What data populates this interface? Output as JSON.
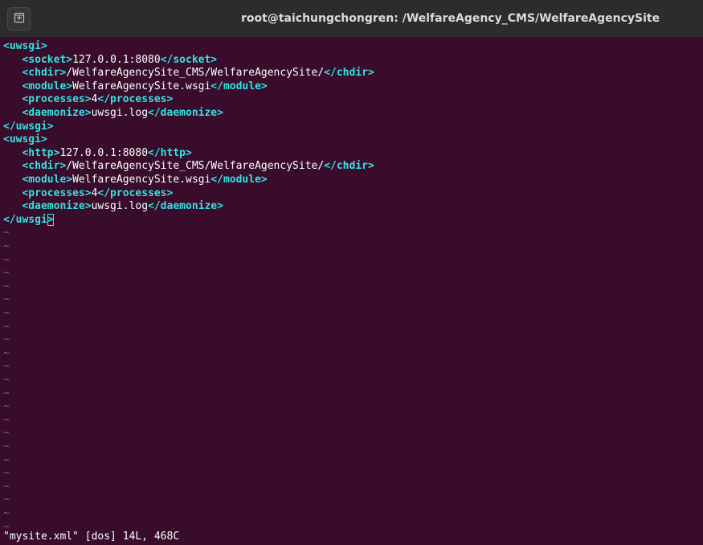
{
  "window": {
    "title": "root@taichungchongren: /WelfareAgency_CMS/WelfareAgencySite",
    "new_tab_icon": "new-tab-icon"
  },
  "lines": [
    [
      {
        "t": "<uwsgi>",
        "c": "tag"
      }
    ],
    [
      {
        "t": "   "
      },
      {
        "t": "<socket>",
        "c": "tag"
      },
      {
        "t": "127.0.0.1:8080"
      },
      {
        "t": "</socket>",
        "c": "tag"
      }
    ],
    [
      {
        "t": "   "
      },
      {
        "t": "<chdir>",
        "c": "tag"
      },
      {
        "t": "/WelfareAgencySite_CMS/WelfareAgencySite/"
      },
      {
        "t": "</chdir>",
        "c": "tag"
      }
    ],
    [
      {
        "t": "   "
      },
      {
        "t": "<module>",
        "c": "tag"
      },
      {
        "t": "WelfareAgencySite.wsgi"
      },
      {
        "t": "</module>",
        "c": "tag"
      }
    ],
    [
      {
        "t": "   "
      },
      {
        "t": "<processes>",
        "c": "tag"
      },
      {
        "t": "4"
      },
      {
        "t": "</processes>",
        "c": "tag"
      }
    ],
    [
      {
        "t": "   "
      },
      {
        "t": "<daemonize>",
        "c": "tag"
      },
      {
        "t": "uwsgi.log"
      },
      {
        "t": "</daemonize>",
        "c": "tag"
      }
    ],
    [
      {
        "t": "</uwsgi>",
        "c": "tag"
      }
    ],
    [
      {
        "t": "<uwsgi>",
        "c": "tag"
      }
    ],
    [
      {
        "t": "   "
      },
      {
        "t": "<http>",
        "c": "tag"
      },
      {
        "t": "127.0.0.1:8080"
      },
      {
        "t": "</http>",
        "c": "tag"
      }
    ],
    [
      {
        "t": "   "
      },
      {
        "t": "<chdir>",
        "c": "tag"
      },
      {
        "t": "/WelfareAgencySite_CMS/WelfareAgencySite/"
      },
      {
        "t": "</chdir>",
        "c": "tag"
      }
    ],
    [
      {
        "t": "   "
      },
      {
        "t": "<module>",
        "c": "tag"
      },
      {
        "t": "WelfareAgencySite.wsgi"
      },
      {
        "t": "</module>",
        "c": "tag"
      }
    ],
    [
      {
        "t": "   "
      },
      {
        "t": "<processes>",
        "c": "tag"
      },
      {
        "t": "4"
      },
      {
        "t": "</processes>",
        "c": "tag"
      }
    ],
    [
      {
        "t": "   "
      },
      {
        "t": "<daemonize>",
        "c": "tag"
      },
      {
        "t": "uwsgi.log"
      },
      {
        "t": "</daemonize>",
        "c": "tag"
      }
    ],
    [
      {
        "t": "</uwsgi",
        "c": "tag"
      },
      {
        "t": ">",
        "c": "tag",
        "cursor": true
      }
    ]
  ],
  "empty_line_marker": "~",
  "empty_line_count": 23,
  "status_line": "\"mysite.xml\" [dos] 14L, 468C",
  "colors": {
    "background": "#380c2a",
    "titlebar": "#2c2c2c",
    "tag": "#34e2e2",
    "text": "#ffffff",
    "tilde": "#6a6a8a"
  }
}
